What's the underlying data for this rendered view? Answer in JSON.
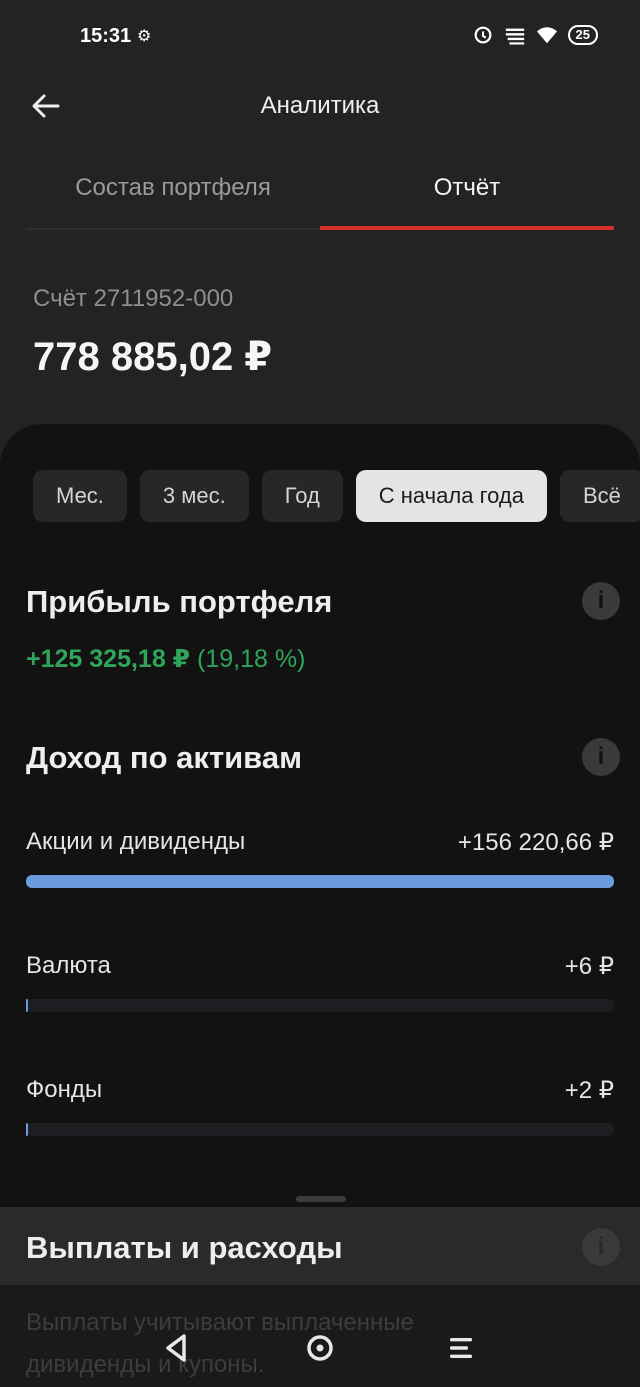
{
  "status_bar": {
    "time": "15:31",
    "battery": "25",
    "gear": "⚙"
  },
  "header": {
    "title": "Аналитика"
  },
  "tabs": [
    {
      "label": "Состав портфеля",
      "active": false
    },
    {
      "label": "Отчёт",
      "active": true
    }
  ],
  "account": {
    "label": "Счёт 2711952-000",
    "balance": "778 885,02 ₽"
  },
  "periods": [
    {
      "label": "Мес.",
      "selected": false
    },
    {
      "label": "3 мес.",
      "selected": false
    },
    {
      "label": "Год",
      "selected": false
    },
    {
      "label": "С начала года",
      "selected": true
    },
    {
      "label": "Всё",
      "selected": false
    }
  ],
  "profit": {
    "title": "Прибыль портфеля",
    "absolute": "+125 325,18 ₽",
    "percent": "(19,18 %)",
    "info": "i"
  },
  "income": {
    "title": "Доход по активам",
    "info": "i",
    "assets": [
      {
        "name": "Акции и дивиденды",
        "value": "+156 220,66 ₽",
        "share": 1.0
      },
      {
        "name": "Валюта",
        "value": "+6 ₽",
        "share": 0.0
      },
      {
        "name": "Фонды",
        "value": "+2 ₽",
        "share": 0.0
      }
    ]
  },
  "payouts": {
    "title": "Выплаты и расходы",
    "info": "i",
    "description": "Выплаты учитывают выплаченные дивиденды и купоны."
  },
  "colors": {
    "accent": "#d3302a",
    "positive": "#2fa45a",
    "bar": "#6a9be0"
  }
}
